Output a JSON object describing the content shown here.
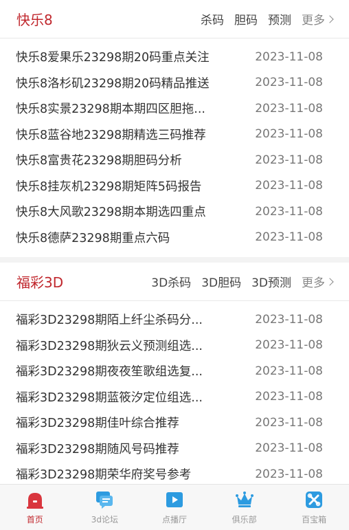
{
  "kl8": {
    "title": "快乐8",
    "links": [
      "杀码",
      "胆码",
      "预测"
    ],
    "more": "更多",
    "items": [
      {
        "title": "快乐8爱果乐23298期20码重点关注",
        "date": "2023-11-08"
      },
      {
        "title": "快乐8洛杉矶23298期20码精品推送",
        "date": "2023-11-08"
      },
      {
        "title": "快乐8实景23298期本期四区胆拖...",
        "date": "2023-11-08"
      },
      {
        "title": "快乐8蓝谷地23298期精选三码推荐",
        "date": "2023-11-08"
      },
      {
        "title": "快乐8富贵花23298期胆码分析",
        "date": "2023-11-08"
      },
      {
        "title": "快乐8挂灰机23298期矩阵5码报告",
        "date": "2023-11-08"
      },
      {
        "title": "快乐8大风歌23298期本期选四重点",
        "date": "2023-11-08"
      },
      {
        "title": "快乐8德萨23298期重点六码",
        "date": "2023-11-08"
      }
    ]
  },
  "fc3d": {
    "title": "福彩3D",
    "links": [
      "3D杀码",
      "3D胆码",
      "3D预测"
    ],
    "more": "更多",
    "items": [
      {
        "title": "福彩3D23298期陌上纤尘杀码分...",
        "date": "2023-11-08"
      },
      {
        "title": "福彩3D23298期狄云义预测组选...",
        "date": "2023-11-08"
      },
      {
        "title": "福彩3D23298期夜夜笙歌组选复...",
        "date": "2023-11-08"
      },
      {
        "title": "福彩3D23298期蓝筱汐定位组选...",
        "date": "2023-11-08"
      },
      {
        "title": "福彩3D23298期佳叶综合推荐",
        "date": "2023-11-08"
      },
      {
        "title": "福彩3D23298期随风号码推荐",
        "date": "2023-11-08"
      },
      {
        "title": "福彩3D23298期荣华府奖号参考",
        "date": "2023-11-08"
      }
    ]
  },
  "tabbar": {
    "tabs": [
      {
        "label": "首页",
        "icon": "home-icon",
        "active": true
      },
      {
        "label": "3d论坛",
        "icon": "chat-icon",
        "active": false
      },
      {
        "label": "点播厅",
        "icon": "play-icon",
        "active": false
      },
      {
        "label": "俱乐部",
        "icon": "crown-icon",
        "active": false
      },
      {
        "label": "百宝箱",
        "icon": "toolbox-icon",
        "active": false
      }
    ]
  },
  "colors": {
    "accent": "#c0272d",
    "icon_blue": "#2d9be0",
    "home_red": "#d9363e"
  }
}
